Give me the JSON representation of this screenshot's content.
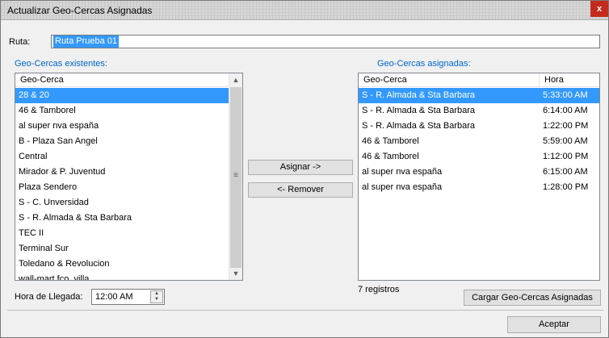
{
  "window": {
    "title": "Actualizar Geo-Cercas Asignadas",
    "close_label": "x"
  },
  "route": {
    "label": "Ruta:",
    "value": "Ruta Prueba 01"
  },
  "existing": {
    "title": "Geo-Cercas existentes:",
    "column": "Geo-Cerca",
    "items": [
      "28 & 20",
      "46 & Tamborel",
      "al super nva españa",
      "B - Plaza San Angel",
      "Central",
      "Mirador & P. Juventud",
      "Plaza Sendero",
      "S - C. Unversidad",
      "S - R. Almada & Sta Barbara",
      "TEC II",
      "Terminal Sur",
      "Toledano & Revolucion",
      "wall-mart fco. villa"
    ],
    "selected_index": 0
  },
  "buttons": {
    "assign": "Asignar ->",
    "remove": "<- Remover",
    "load_assigned": "Cargar Geo-Cercas Asignadas",
    "accept": "Aceptar"
  },
  "assigned": {
    "title": "Geo-Cercas asignadas:",
    "columns": [
      "Geo-Cerca",
      "Hora"
    ],
    "rows": [
      {
        "name": "S - R. Almada & Sta Barbara",
        "time": "5:33:00 AM"
      },
      {
        "name": "S - R. Almada & Sta Barbara",
        "time": "6:14:00 AM"
      },
      {
        "name": "S - R. Almada & Sta Barbara",
        "time": "1:22:00 PM"
      },
      {
        "name": "46 & Tamborel",
        "time": "5:59:00 AM"
      },
      {
        "name": "46 & Tamborel",
        "time": "1:12:00 PM"
      },
      {
        "name": "al super nva españa",
        "time": "6:15:00 AM"
      },
      {
        "name": "al super nva españa",
        "time": "1:28:00 PM"
      }
    ],
    "selected_index": 0,
    "record_count": "7 registros"
  },
  "arrival": {
    "label": "Hora de Llegada:",
    "value": "12:00 AM"
  },
  "colors": {
    "selection": "#3399ff",
    "accent_label": "#0066cc",
    "close": "#c42b1c"
  }
}
